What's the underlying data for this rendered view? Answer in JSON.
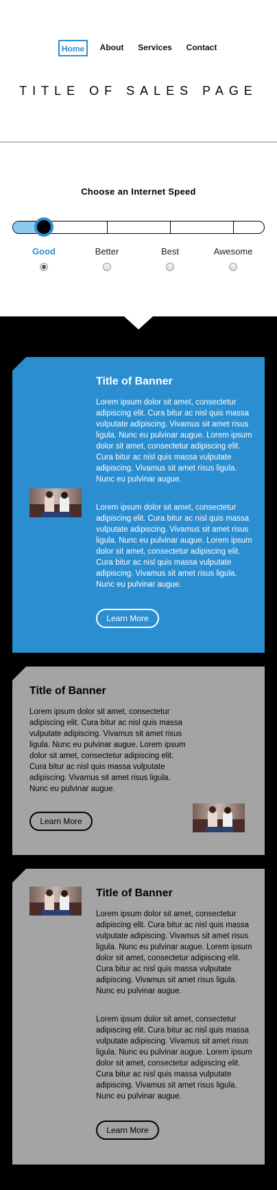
{
  "nav": {
    "items": [
      {
        "label": "Home",
        "active": true
      },
      {
        "label": "About",
        "active": false
      },
      {
        "label": "Services",
        "active": false
      },
      {
        "label": "Contact",
        "active": false
      }
    ]
  },
  "page_title": "TITLE OF SALES PAGE",
  "speed": {
    "title": "Choose an Internet Speed",
    "options": [
      "Good",
      "Better",
      "Best",
      "Awesome"
    ],
    "selected": "Good",
    "accent_color": "#2b8ed0"
  },
  "banners": [
    {
      "style": "blue",
      "title": "Title of Banner",
      "paragraphs": [
        "Lorem ipsum dolor sit amet, consectetur adipiscing elit. Cura bitur ac nisl quis massa vulputate adipiscing. Vivamus sit amet risus ligula. Nunc eu pulvinar augue. Lorem ipsum dolor sit amet, consectetur adipiscing elit. Cura bitur ac nisl quis massa vulputate adipiscing. Vivamus sit amet risus ligula. Nunc eu pulvinar augue.",
        "Lorem ipsum dolor sit amet, consectetur adipiscing elit. Cura bitur ac nisl quis massa vulputate adipiscing. Vivamus sit amet risus ligula. Nunc eu pulvinar augue. Lorem ipsum dolor sit amet, consectetur adipiscing elit. Cura bitur ac nisl quis massa vulputate adipiscing. Vivamus sit amet risus ligula. Nunc eu pulvinar augue."
      ],
      "button": "Learn More",
      "color": "#2b8ed0"
    },
    {
      "style": "gray",
      "title": "Title of Banner",
      "paragraphs": [
        "Lorem ipsum dolor sit amet, consectetur adipiscing elit. Cura bitur ac nisl quis massa vulputate adipiscing. Vivamus sit amet risus ligula. Nunc eu pulvinar augue. Lorem ipsum dolor sit amet, consectetur adipiscing elit. Cura bitur ac nisl quis massa vulputate adipiscing. Vivamus sit amet risus ligula. Nunc eu pulvinar augue."
      ],
      "button": "Learn More",
      "color": "#a4a4a4"
    },
    {
      "style": "gray",
      "title": "Title of Banner",
      "paragraphs": [
        "Lorem ipsum dolor sit amet, consectetur adipiscing elit. Cura bitur ac nisl quis massa vulputate adipiscing. Vivamus sit amet risus ligula. Nunc eu pulvinar augue. Lorem ipsum dolor sit amet, consectetur adipiscing elit. Cura bitur ac nisl quis massa vulputate adipiscing. Vivamus sit amet risus ligula. Nunc eu pulvinar augue.",
        "Lorem ipsum dolor sit amet, consectetur adipiscing elit. Cura bitur ac nisl quis massa vulputate adipiscing. Vivamus sit amet risus ligula. Nunc eu pulvinar augue. Lorem ipsum dolor sit amet, consectetur adipiscing elit. Cura bitur ac nisl quis massa vulputate adipiscing. Vivamus sit amet risus ligula. Nunc eu pulvinar augue."
      ],
      "button": "Learn More",
      "color": "#a4a4a4"
    }
  ]
}
